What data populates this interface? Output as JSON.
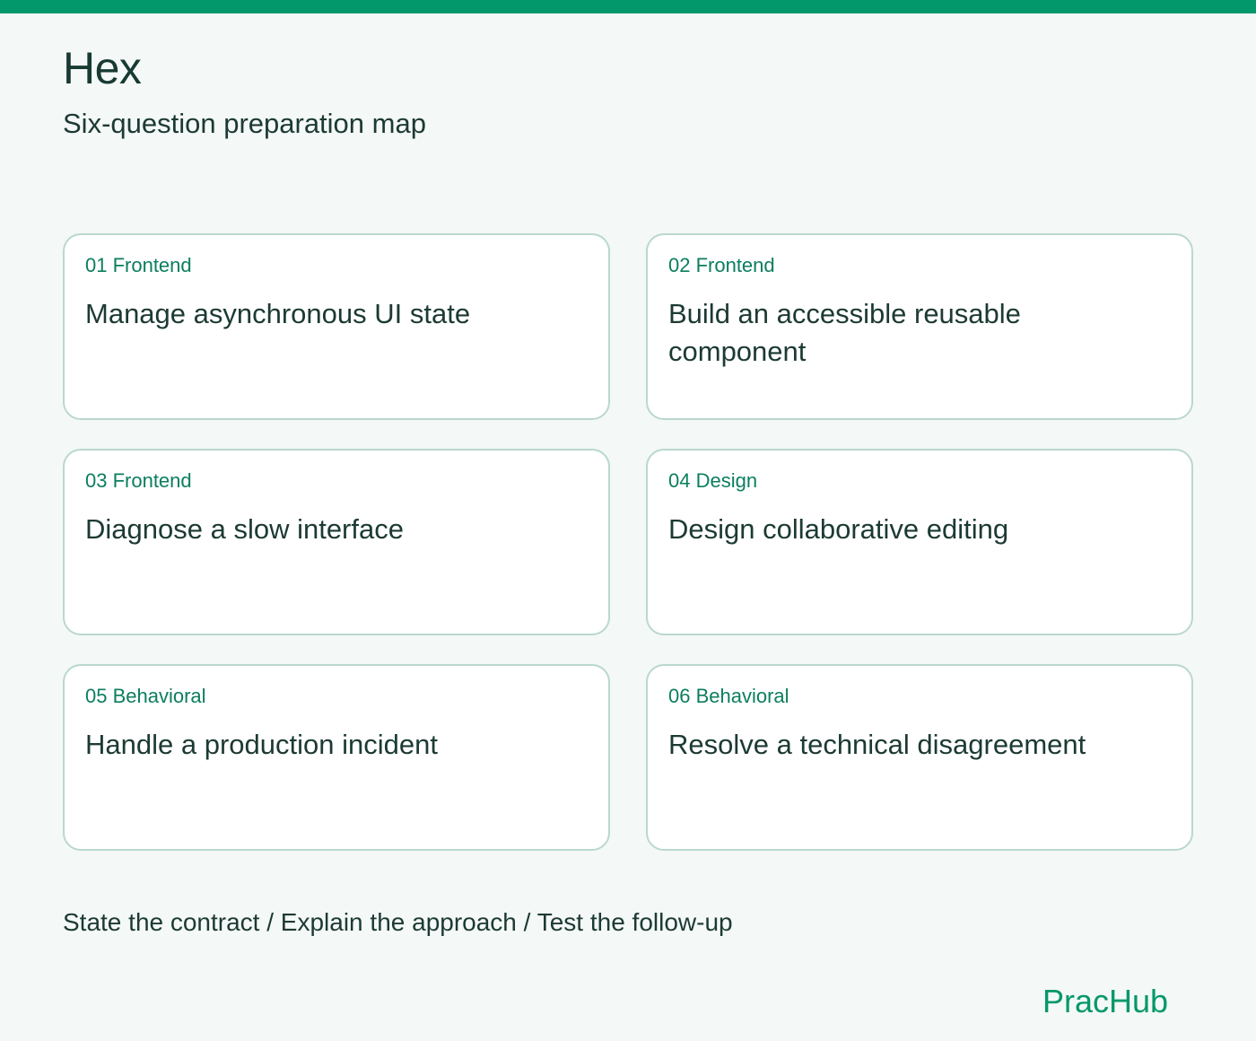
{
  "header": {
    "title": "Hex",
    "subtitle": "Six-question preparation map"
  },
  "cards": [
    {
      "tag": "01 Frontend",
      "title": "Manage asynchronous UI state"
    },
    {
      "tag": "02 Frontend",
      "title": "Build an accessible reusable component"
    },
    {
      "tag": "03 Frontend",
      "title": "Diagnose a slow interface"
    },
    {
      "tag": "04 Design",
      "title": "Design collaborative editing"
    },
    {
      "tag": "05 Behavioral",
      "title": "Handle a production incident"
    },
    {
      "tag": "06 Behavioral",
      "title": "Resolve a technical disagreement"
    }
  ],
  "footer": {
    "steps": "State the contract / Explain the approach / Test the follow-up",
    "brand": "PracHub"
  },
  "colors": {
    "accent": "#03986b",
    "tag_text": "#0b7e5e",
    "card_border": "#b9d8cf",
    "background": "#f4f8f7",
    "text": "#1c3a33"
  }
}
